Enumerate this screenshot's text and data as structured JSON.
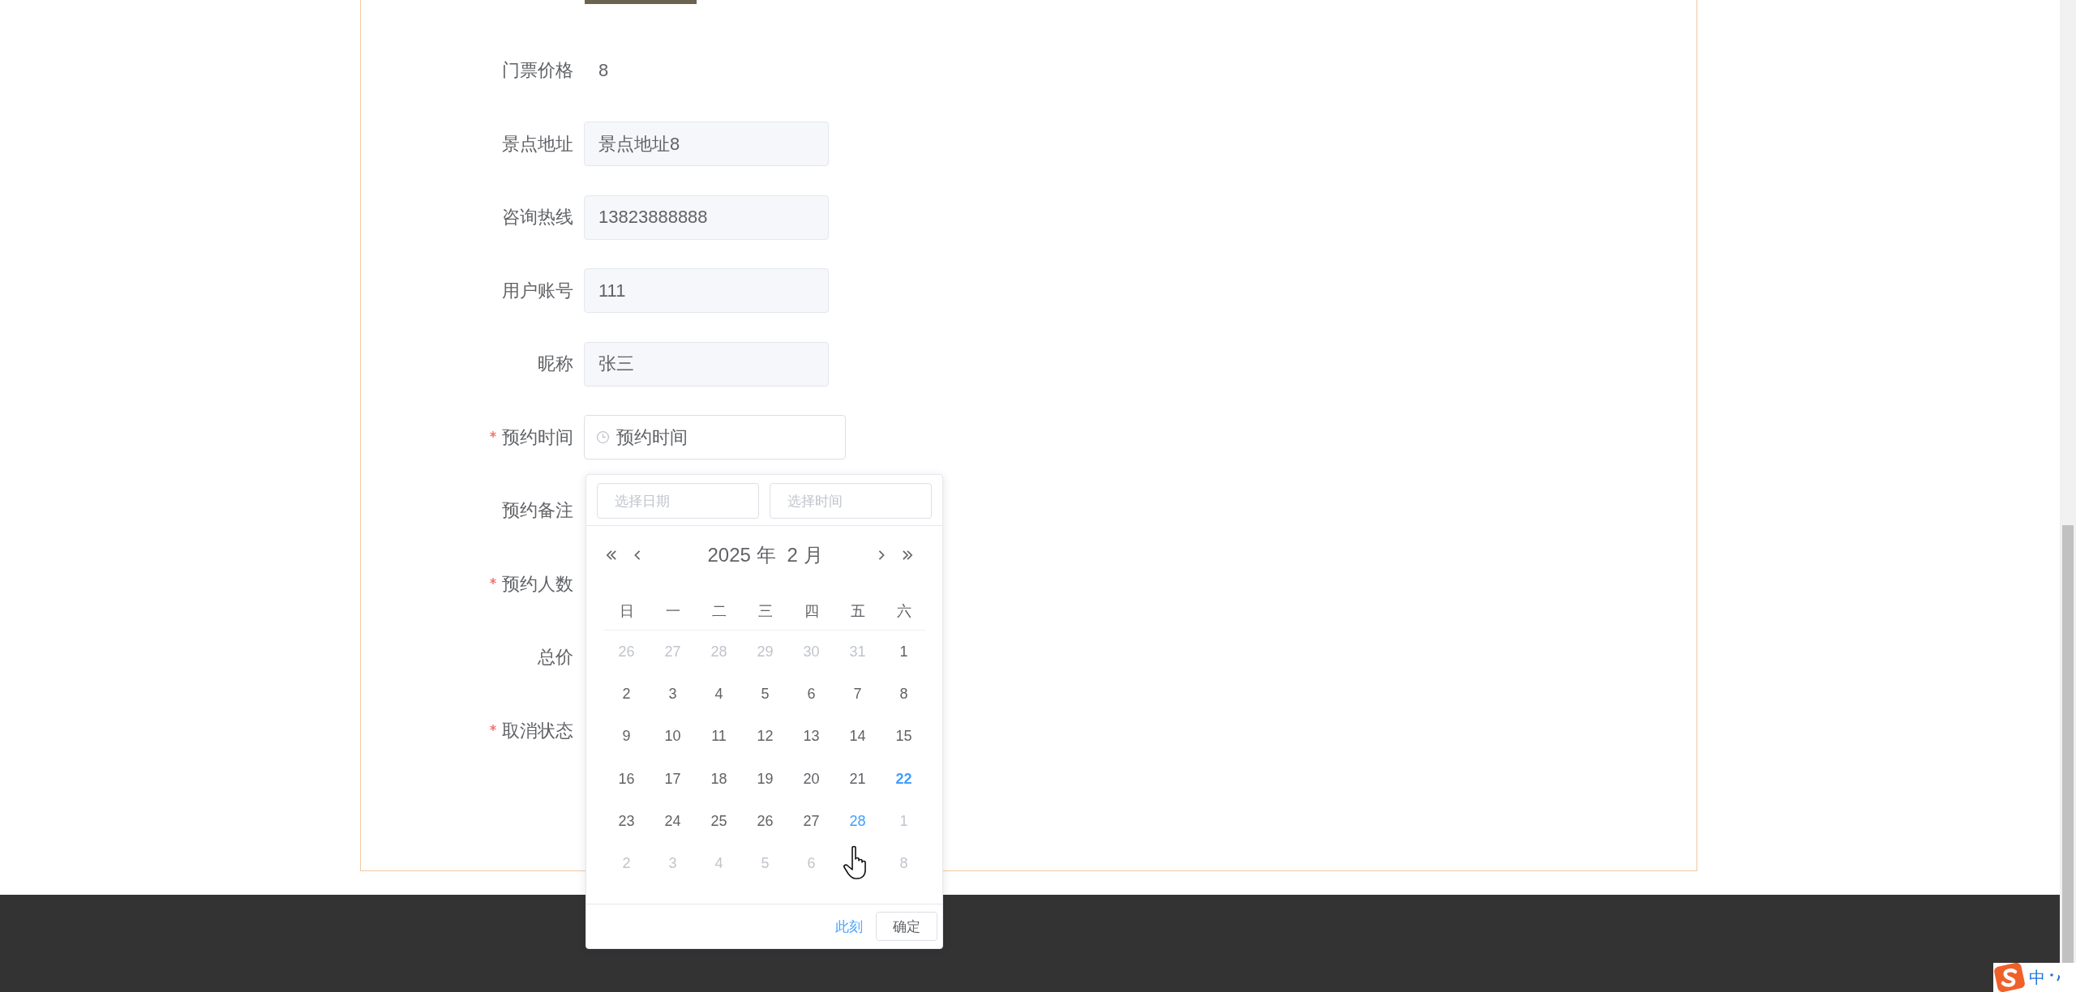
{
  "form": {
    "rows": [
      {
        "label": "门票价格",
        "required": false,
        "kind": "text",
        "value": "8"
      },
      {
        "label": "景点地址",
        "required": false,
        "kind": "readonly",
        "value": "景点地址8"
      },
      {
        "label": "咨询热线",
        "required": false,
        "kind": "readonly",
        "value": "13823888888"
      },
      {
        "label": "用户账号",
        "required": false,
        "kind": "readonly",
        "value": "111"
      },
      {
        "label": "昵称",
        "required": false,
        "kind": "readonly",
        "value": "张三"
      },
      {
        "label": "预约时间",
        "required": true,
        "kind": "datetime",
        "value": "预约时间"
      },
      {
        "label": "预约备注",
        "required": false,
        "kind": "covered"
      },
      {
        "label": "预约人数",
        "required": true,
        "kind": "covered"
      },
      {
        "label": "总价",
        "required": false,
        "kind": "covered"
      },
      {
        "label": "取消状态",
        "required": true,
        "kind": "covered"
      }
    ]
  },
  "date_picker": {
    "date_placeholder": "选择日期",
    "time_placeholder": "选择时间",
    "year_label": "2025 年",
    "month_label": "2 月",
    "weekdays": [
      "日",
      "一",
      "二",
      "三",
      "四",
      "五",
      "六"
    ],
    "weeks": [
      [
        {
          "text": "26",
          "kind": "other"
        },
        {
          "text": "27",
          "kind": "other"
        },
        {
          "text": "28",
          "kind": "other"
        },
        {
          "text": "29",
          "kind": "other"
        },
        {
          "text": "30",
          "kind": "other"
        },
        {
          "text": "31",
          "kind": "other"
        },
        {
          "text": "1",
          "kind": "normal"
        }
      ],
      [
        {
          "text": "2",
          "kind": "normal"
        },
        {
          "text": "3",
          "kind": "normal"
        },
        {
          "text": "4",
          "kind": "normal"
        },
        {
          "text": "5",
          "kind": "normal"
        },
        {
          "text": "6",
          "kind": "normal"
        },
        {
          "text": "7",
          "kind": "normal"
        },
        {
          "text": "8",
          "kind": "normal"
        }
      ],
      [
        {
          "text": "9",
          "kind": "normal"
        },
        {
          "text": "10",
          "kind": "normal"
        },
        {
          "text": "11",
          "kind": "normal"
        },
        {
          "text": "12",
          "kind": "normal"
        },
        {
          "text": "13",
          "kind": "normal"
        },
        {
          "text": "14",
          "kind": "normal"
        },
        {
          "text": "15",
          "kind": "normal"
        }
      ],
      [
        {
          "text": "16",
          "kind": "normal"
        },
        {
          "text": "17",
          "kind": "normal"
        },
        {
          "text": "18",
          "kind": "normal"
        },
        {
          "text": "19",
          "kind": "normal"
        },
        {
          "text": "20",
          "kind": "normal"
        },
        {
          "text": "21",
          "kind": "normal"
        },
        {
          "text": "22",
          "kind": "today"
        }
      ],
      [
        {
          "text": "23",
          "kind": "normal"
        },
        {
          "text": "24",
          "kind": "normal"
        },
        {
          "text": "25",
          "kind": "normal"
        },
        {
          "text": "26",
          "kind": "normal"
        },
        {
          "text": "27",
          "kind": "normal"
        },
        {
          "text": "28",
          "kind": "accent"
        },
        {
          "text": "1",
          "kind": "other"
        }
      ],
      [
        {
          "text": "2",
          "kind": "other"
        },
        {
          "text": "3",
          "kind": "other"
        },
        {
          "text": "4",
          "kind": "other"
        },
        {
          "text": "5",
          "kind": "other"
        },
        {
          "text": "6",
          "kind": "other"
        },
        {
          "kind": "covered"
        },
        {
          "text": "8",
          "kind": "other"
        }
      ]
    ],
    "now_link": "此刻",
    "confirm_button": "确定"
  },
  "ime": {
    "mode": "中"
  }
}
